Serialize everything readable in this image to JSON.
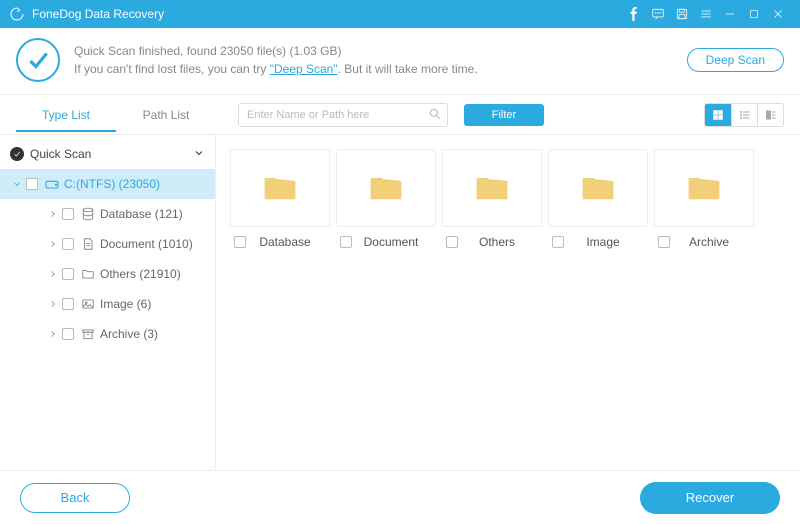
{
  "app": {
    "title": "FoneDog Data Recovery"
  },
  "header": {
    "line1": "Quick Scan finished, found 23050 file(s) (1.03 GB)",
    "line2_prefix": "If you can't find lost files, you can try ",
    "line2_link": "\"Deep Scan\"",
    "line2_suffix": ". But it will take more time.",
    "deep_scan_label": "Deep Scan"
  },
  "tabs": {
    "type_list": "Type List",
    "path_list": "Path List"
  },
  "search": {
    "placeholder": "Enter Name or Path here"
  },
  "filter": {
    "label": "Filter"
  },
  "sidebar": {
    "quick_scan": "Quick Scan",
    "drive": "C:(NTFS) (23050)",
    "items": [
      {
        "label": "Database (121)"
      },
      {
        "label": "Document (1010)"
      },
      {
        "label": "Others (21910)"
      },
      {
        "label": "Image (6)"
      },
      {
        "label": "Archive (3)"
      }
    ]
  },
  "grid": {
    "items": [
      {
        "label": "Database"
      },
      {
        "label": "Document"
      },
      {
        "label": "Others"
      },
      {
        "label": "Image"
      },
      {
        "label": "Archive"
      }
    ]
  },
  "footer": {
    "back": "Back",
    "recover": "Recover"
  }
}
